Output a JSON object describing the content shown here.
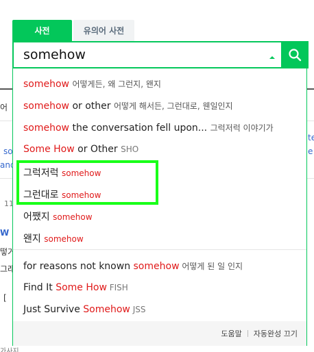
{
  "tabs": [
    {
      "label": "사전",
      "active": true
    },
    {
      "label": "유의어 사전",
      "active": false
    }
  ],
  "search": {
    "value": "somehow"
  },
  "background": {
    "frag_eo": "어",
    "frag_so": "so",
    "frag_and": "and",
    "frag_te": "te",
    "frag_e": "e",
    "frag_11": "11",
    "frag_w": "W",
    "frag_ddeo": "떻거",
    "frag_geurae": "그래",
    "frag_bracket": "[",
    "frag_bottom": "가사지"
  },
  "suggestions": [
    {
      "kw": "somehow",
      "en": "",
      "ko": "어떻게든, 왜 그런지, 왠지",
      "tag": ""
    },
    {
      "kw": "somehow",
      "en": " or other ",
      "ko": "어떻게 해서든, 그런대로, 웬일인지",
      "tag": ""
    },
    {
      "kw": "somehow",
      "en": " the conversation fell upon... ",
      "ko": "그럭저럭 이야기가",
      "tag": ""
    },
    {
      "kw": "Some How",
      "en": " or Other ",
      "ko": "",
      "tag": "SHO"
    },
    {
      "pre": "그럭저럭 ",
      "kw": "somehow"
    },
    {
      "pre": "그런대로 ",
      "kw": "somehow"
    },
    {
      "pre": "어쨌지 ",
      "kw": "somehow"
    },
    {
      "pre": "왠지 ",
      "kw": "somehow"
    }
  ],
  "phrases": [
    {
      "pre": "for reasons not known ",
      "kw": "somehow",
      "ko": " 어떻게 된 일 인지",
      "tag": ""
    },
    {
      "pre": "Find It ",
      "kw": "Some How",
      "ko": "",
      "tag": " FISH"
    },
    {
      "pre": "Just Survive ",
      "kw": "Somehow",
      "ko": "",
      "tag": " JSS"
    }
  ],
  "footer": {
    "help": "도움말",
    "autocomplete_off": "자동완성 끄기"
  },
  "colors": {
    "accent": "#03c75a",
    "keyword": "#e01919",
    "highlight": "#19ff19"
  }
}
